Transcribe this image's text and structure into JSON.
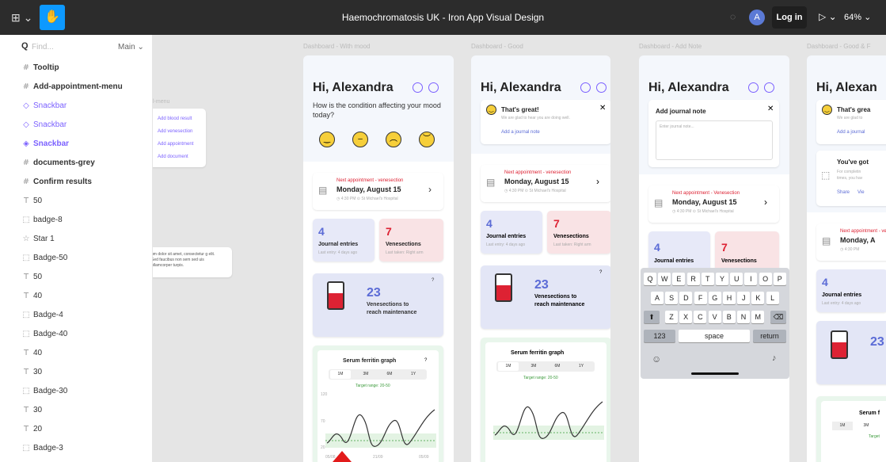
{
  "topbar": {
    "title": "Haemochromatosis UK - Iron App Visual Design",
    "login": "Log in",
    "zoom": "64%",
    "avatar": "A"
  },
  "sidebar": {
    "find_placeholder": "Find...",
    "page": "Main",
    "layers": [
      {
        "icon": "#",
        "label": "Tooltip",
        "bold": true,
        "purple": false
      },
      {
        "icon": "#",
        "label": "Add-appointment-menu",
        "bold": true,
        "purple": false
      },
      {
        "icon": "◇",
        "label": "Snackbar",
        "bold": false,
        "purple": true
      },
      {
        "icon": "◇",
        "label": "Snackbar",
        "bold": false,
        "purple": true
      },
      {
        "icon": "◈",
        "label": "Snackbar",
        "bold": true,
        "purple": true
      },
      {
        "icon": "#",
        "label": "documents-grey",
        "bold": true,
        "purple": false
      },
      {
        "icon": "#",
        "label": "Confirm results",
        "bold": true,
        "purple": false
      },
      {
        "icon": "T",
        "label": "50",
        "bold": false,
        "purple": false
      },
      {
        "icon": "⬚",
        "label": "badge-8",
        "bold": false,
        "purple": false
      },
      {
        "icon": "☆",
        "label": "Star 1",
        "bold": false,
        "purple": false
      },
      {
        "icon": "⬚",
        "label": "Badge-50",
        "bold": false,
        "purple": false
      },
      {
        "icon": "T",
        "label": "50",
        "bold": false,
        "purple": false
      },
      {
        "icon": "T",
        "label": "40",
        "bold": false,
        "purple": false
      },
      {
        "icon": "⬚",
        "label": "Badge-4",
        "bold": false,
        "purple": false
      },
      {
        "icon": "⬚",
        "label": "Badge-40",
        "bold": false,
        "purple": false
      },
      {
        "icon": "T",
        "label": "40",
        "bold": false,
        "purple": false
      },
      {
        "icon": "T",
        "label": "30",
        "bold": false,
        "purple": false
      },
      {
        "icon": "⬚",
        "label": "Badge-30",
        "bold": false,
        "purple": false
      },
      {
        "icon": "T",
        "label": "30",
        "bold": false,
        "purple": false
      },
      {
        "icon": "T",
        "label": "20",
        "bold": false,
        "purple": false
      },
      {
        "icon": "⬚",
        "label": "Badge-3",
        "bold": false,
        "purple": false
      }
    ]
  },
  "frame_labels": [
    "Dashboard - With mood",
    "Dashboard - Good",
    "Dashboard - Add Note",
    "Dashboard - Good & F"
  ],
  "menu_fragment": {
    "title": "l-menu",
    "items": [
      "Add blood result",
      "Add venesection",
      "Add appointment",
      "Add document"
    ]
  },
  "tooltip_fragment": "um dolor sit amet, consectetur g elit. Sed faucibus non sem sed uis ullamcorper turpis.",
  "greeting": "Hi, Alexandra",
  "greeting_clipped": "Hi, Alexan",
  "mood_question": "How is the condition affecting your mood today?",
  "great": {
    "title": "That's great!",
    "sub": "We are glad to hear you are doing well.",
    "link": "Add a journal note",
    "title_clipped": "That's grea",
    "sub_clipped": "We are glad to",
    "link_clipped": "Add a journal"
  },
  "journal_note": {
    "title": "Add journal note",
    "placeholder": "Enter journal note..."
  },
  "appointment": {
    "kind": "Next appointment - venesection",
    "kind_alt": "Next appointment - Venesection",
    "date": "Monday, August 15",
    "time": "4:30 PM",
    "place": "St Michael's Hospital",
    "date_clipped": "Monday, A"
  },
  "stats": {
    "journal_count": "4",
    "journal_label": "Journal entries",
    "journal_sub": "Last entry: 4 days ago",
    "vene_count": "7",
    "vene_label": "Venesections",
    "vene_sub": "Last taken: Right arm"
  },
  "maintenance": {
    "count": "23",
    "label": "Venesections to reach maintenance",
    "line1": "Venesections to",
    "line2": "reach maintenance",
    "help": "?"
  },
  "youve_got": {
    "title": "You've got",
    "sub1": "For completin",
    "sub2": "times, you hav",
    "share": "Share",
    "view": "Vie"
  },
  "ferritin": {
    "title": "Serum ferritin graph",
    "tabs": [
      "1M",
      "3M",
      "6M",
      "1Y"
    ],
    "target": "Target range: 20-50",
    "yticks": [
      "120",
      "70",
      "20"
    ],
    "xticks": [
      "05/08",
      "21/09",
      "05/09"
    ],
    "title_clipped": "Serum f",
    "target_clipped": "Target"
  },
  "keyboard": {
    "row1": [
      "Q",
      "W",
      "E",
      "R",
      "T",
      "Y",
      "U",
      "I",
      "O",
      "P"
    ],
    "row2": [
      "A",
      "S",
      "D",
      "F",
      "G",
      "H",
      "J",
      "K",
      "L"
    ],
    "row3": [
      "Z",
      "X",
      "C",
      "V",
      "B",
      "N",
      "M"
    ],
    "num": "123",
    "space": "space",
    "return": "return"
  },
  "colors": {
    "purple": "#7b61ff",
    "blue": "#0d99ff",
    "red": "#d2263a",
    "green_line": "#3a9a3a"
  }
}
